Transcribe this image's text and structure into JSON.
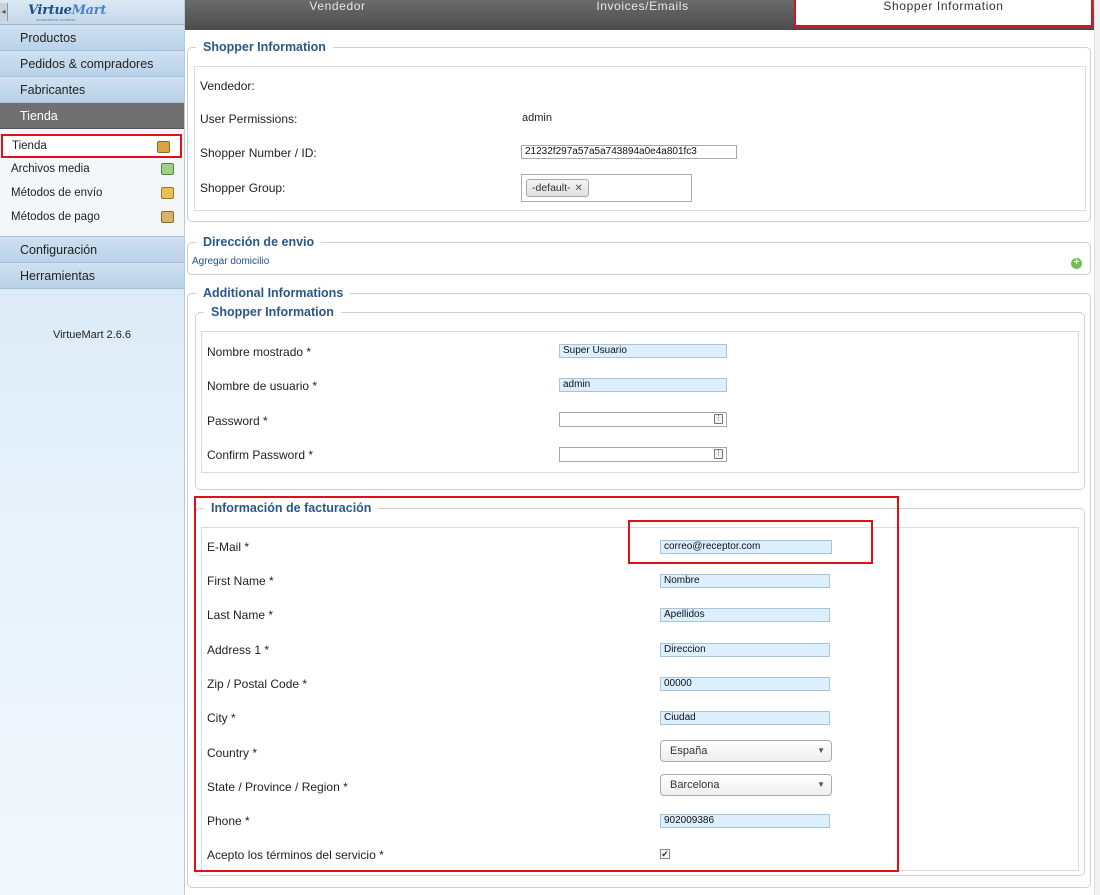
{
  "sidebar": {
    "logo_main": "Virtue",
    "logo_light": "Mart",
    "logo_tagline": "ecommerce solution",
    "menu": [
      "Productos",
      "Pedidos & compradores",
      "Fabricantes",
      "Tienda"
    ],
    "submenu": [
      {
        "label": "Tienda",
        "icon": "store-icon",
        "color": "#d9a441"
      },
      {
        "label": "Archivos media",
        "icon": "media-icon",
        "color": "#7fb06b"
      },
      {
        "label": "Métodos de envío",
        "icon": "truck-icon",
        "color": "#e3b14a"
      },
      {
        "label": "Métodos de pago",
        "icon": "payment-icon",
        "color": "#caa45a"
      }
    ],
    "menu_bottom": [
      "Configuración",
      "Herramientas"
    ],
    "version": "VirtueMart 2.6.6"
  },
  "tabs": [
    "Vendedor",
    "Invoices/Emails",
    "Shopper Information"
  ],
  "shopper": {
    "legend": "Shopper Information",
    "vendor_label": "Vendedor:",
    "perm_label": "User Permissions:",
    "perm_value": "admin",
    "id_label": "Shopper Number / ID:",
    "id_value": "21232f297a57a5a743894a0e4a801fc3",
    "group_label": "Shopper Group:",
    "group_chip": "-default-",
    "chip_remove": "✕"
  },
  "shipping": {
    "legend": "Dirección de envio",
    "add_link": "Agregar domicilio"
  },
  "additional": {
    "legend": "Additional Informations",
    "inner_legend": "Shopper Information",
    "display_name_label": "Nombre mostrado *",
    "display_name_value": "Super Usuario",
    "username_label": "Nombre de usuario *",
    "username_value": "admin",
    "password_label": "Password *",
    "confirm_label": "Confirm Password *"
  },
  "billing": {
    "legend": "Información de facturación",
    "fields": [
      {
        "label": "E-Mail *",
        "value": "correo@receptor.com"
      },
      {
        "label": "First Name *",
        "value": "Nombre"
      },
      {
        "label": "Last Name *",
        "value": "Apellidos"
      },
      {
        "label": "Address 1 *",
        "value": "Direccion"
      },
      {
        "label": "Zip / Postal Code *",
        "value": "00000"
      },
      {
        "label": "City *",
        "value": "Ciudad"
      }
    ],
    "country_label": "Country *",
    "country_value": "España",
    "state_label": "State / Province / Region *",
    "state_value": "Barcelona",
    "phone_label": "Phone *",
    "phone_value": "902009386",
    "terms_label": "Acepto los términos del servicio *",
    "terms_checked": "✔"
  }
}
